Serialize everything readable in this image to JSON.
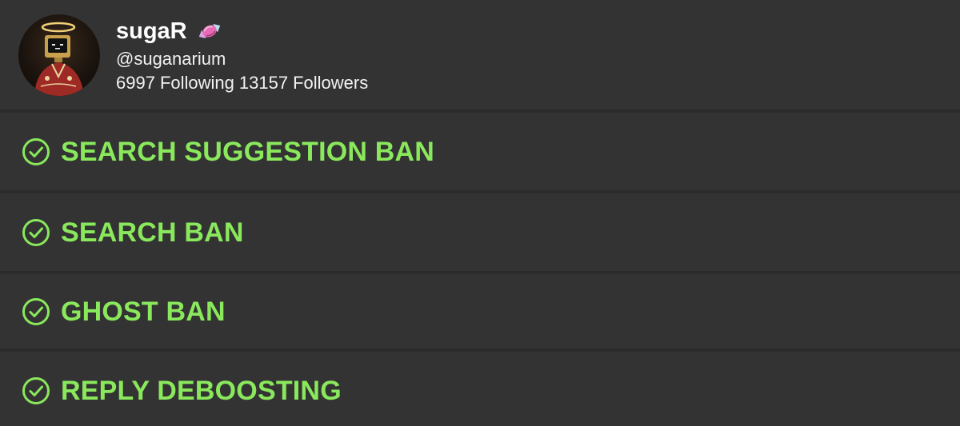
{
  "profile": {
    "display_name": "sugaR",
    "name_emoji": "candy-icon",
    "handle": "@suganarium",
    "following_count": "6997",
    "following_label": "Following",
    "followers_count": "13157",
    "followers_label": "Followers"
  },
  "checks": [
    {
      "label": "SEARCH SUGGESTION BAN",
      "icon": "check-circle-icon",
      "status_color": "#8ae85c"
    },
    {
      "label": "SEARCH BAN",
      "icon": "check-circle-icon",
      "status_color": "#8ae85c"
    },
    {
      "label": "GHOST BAN",
      "icon": "check-circle-icon",
      "status_color": "#8ae85c"
    },
    {
      "label": "REPLY DEBOOSTING",
      "icon": "check-circle-icon",
      "status_color": "#8ae85c"
    }
  ],
  "colors": {
    "background": "#333333",
    "accent_green": "#8ae85c",
    "text": "#ffffff"
  }
}
